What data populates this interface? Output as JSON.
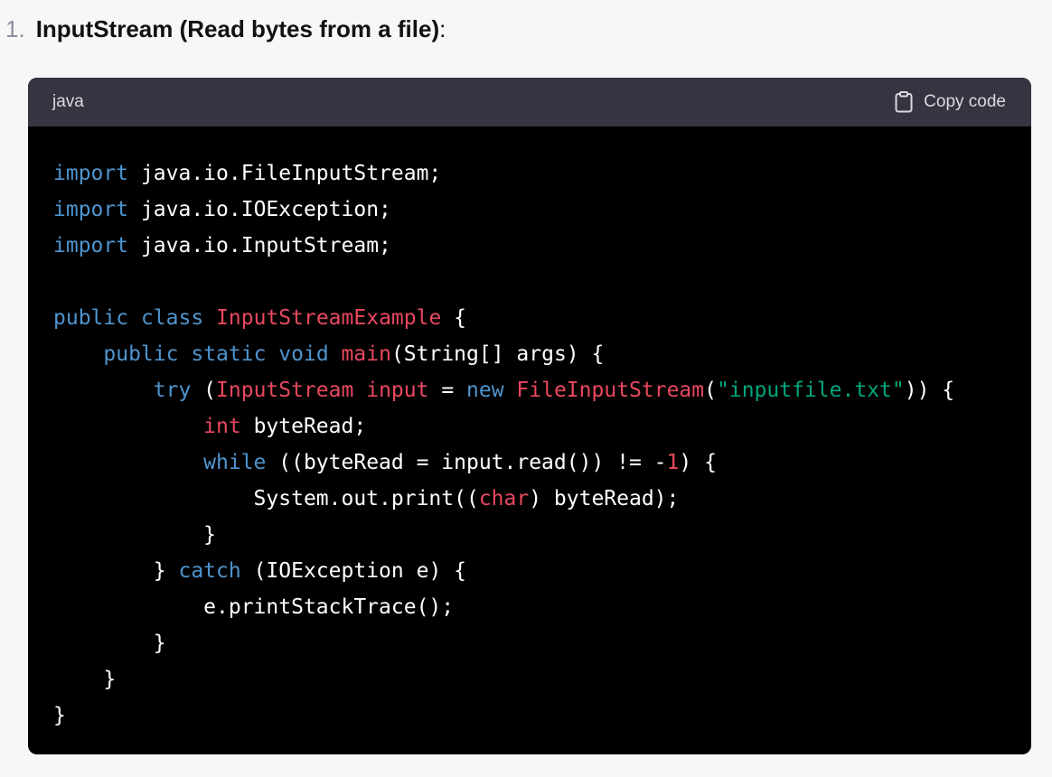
{
  "heading": {
    "number": "1.",
    "title": "InputStream (Read bytes from a file)",
    "suffix": ":"
  },
  "code_block": {
    "language": "java",
    "copy_label": "Copy code",
    "copy_icon": "clipboard-icon",
    "lines": [
      [
        {
          "t": "kw",
          "v": "import"
        },
        {
          "t": "plain",
          "v": " java.io.FileInputStream;"
        }
      ],
      [
        {
          "t": "kw",
          "v": "import"
        },
        {
          "t": "plain",
          "v": " java.io.IOException;"
        }
      ],
      [
        {
          "t": "kw",
          "v": "import"
        },
        {
          "t": "plain",
          "v": " java.io.InputStream;"
        }
      ],
      [],
      [
        {
          "t": "kw",
          "v": "public"
        },
        {
          "t": "plain",
          "v": " "
        },
        {
          "t": "kw",
          "v": "class"
        },
        {
          "t": "plain",
          "v": " "
        },
        {
          "t": "cls",
          "v": "InputStreamExample"
        },
        {
          "t": "plain",
          "v": " {"
        }
      ],
      [
        {
          "t": "plain",
          "v": "    "
        },
        {
          "t": "kw",
          "v": "public"
        },
        {
          "t": "plain",
          "v": " "
        },
        {
          "t": "kw",
          "v": "static"
        },
        {
          "t": "plain",
          "v": " "
        },
        {
          "t": "kw",
          "v": "void"
        },
        {
          "t": "plain",
          "v": " "
        },
        {
          "t": "fn",
          "v": "main"
        },
        {
          "t": "plain",
          "v": "(String[] args) {"
        }
      ],
      [
        {
          "t": "plain",
          "v": "        "
        },
        {
          "t": "kw",
          "v": "try"
        },
        {
          "t": "plain",
          "v": " ("
        },
        {
          "t": "cls",
          "v": "InputStream"
        },
        {
          "t": "plain",
          "v": " "
        },
        {
          "t": "cls",
          "v": "input"
        },
        {
          "t": "plain",
          "v": " = "
        },
        {
          "t": "kw",
          "v": "new"
        },
        {
          "t": "plain",
          "v": " "
        },
        {
          "t": "fn",
          "v": "FileInputStream"
        },
        {
          "t": "plain",
          "v": "("
        },
        {
          "t": "str",
          "v": "\"inputfile.txt\""
        },
        {
          "t": "plain",
          "v": ")) {"
        }
      ],
      [
        {
          "t": "plain",
          "v": "            "
        },
        {
          "t": "type",
          "v": "int"
        },
        {
          "t": "plain",
          "v": " byteRead;"
        }
      ],
      [
        {
          "t": "plain",
          "v": "            "
        },
        {
          "t": "kw",
          "v": "while"
        },
        {
          "t": "plain",
          "v": " ((byteRead = input.read()) != -"
        },
        {
          "t": "num",
          "v": "1"
        },
        {
          "t": "plain",
          "v": ") {"
        }
      ],
      [
        {
          "t": "plain",
          "v": "                System.out.print(("
        },
        {
          "t": "type",
          "v": "char"
        },
        {
          "t": "plain",
          "v": ") byteRead);"
        }
      ],
      [
        {
          "t": "plain",
          "v": "            }"
        }
      ],
      [
        {
          "t": "plain",
          "v": "        } "
        },
        {
          "t": "kw",
          "v": "catch"
        },
        {
          "t": "plain",
          "v": " (IOException e) {"
        }
      ],
      [
        {
          "t": "plain",
          "v": "            e.printStackTrace();"
        }
      ],
      [
        {
          "t": "plain",
          "v": "        }"
        }
      ],
      [
        {
          "t": "plain",
          "v": "    }"
        }
      ],
      [
        {
          "t": "plain",
          "v": "}"
        }
      ]
    ]
  },
  "colors": {
    "page_background": "#f7f7f8",
    "code_header": "#343541",
    "code_background": "#000000",
    "keyword": "#4e94ce",
    "class_name": "#e9485f",
    "string": "#00a67d"
  }
}
